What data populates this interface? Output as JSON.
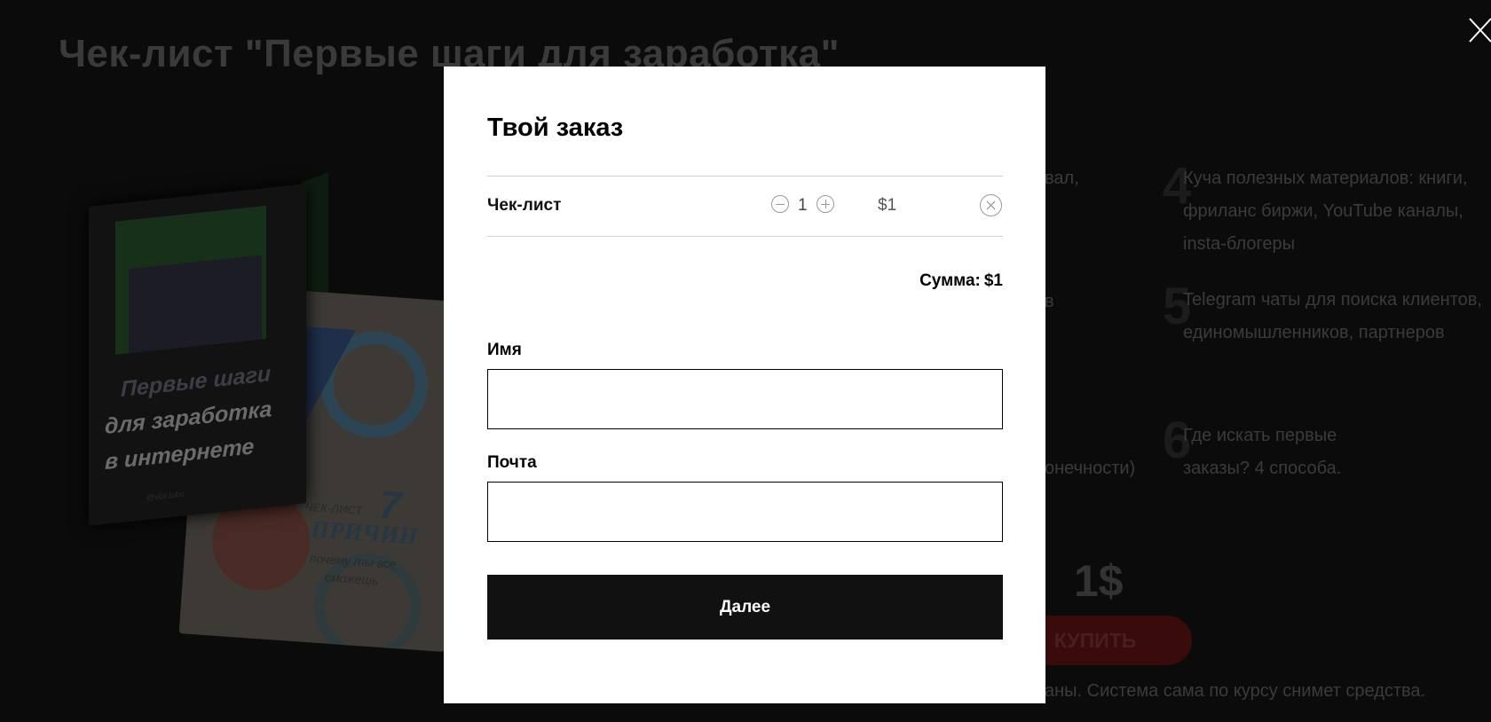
{
  "background": {
    "title": "Чек-лист \"Первые шаги для заработка\"",
    "cover_front": {
      "line1": "Первые шаги",
      "line2": "для заработка",
      "line3": "в интернете",
      "handle": "@vipr.tubs"
    },
    "cover_back": {
      "label": "ЧЕК-ЛИСТ",
      "number": "7",
      "title": "ПРИЧИН",
      "subtitle": "почему ты все сможешь"
    },
    "list": [
      {
        "num": "4",
        "text": "Куча полезных материалов: книги, фриланс биржи, YouTube каналы, insta-блогеры"
      },
      {
        "num": "5",
        "text": "Telegram чаты для поиска клиентов, единомышленников, партнеров"
      },
      {
        "num": "6",
        "text": "Где искать первые заказы? 4 способа."
      }
    ],
    "partial_fragments": [
      "вал,",
      "в",
      "онечности)"
    ],
    "price": "1$",
    "buy_label": "КУПИТЬ",
    "note": "аны. Система сама по курсу снимет средства."
  },
  "modal": {
    "title": "Твой заказ",
    "item": {
      "name": "Чек-лист",
      "quantity": "1",
      "price": "$1"
    },
    "sum_label": "Сумма:",
    "sum_value": "$1",
    "name_label": "Имя",
    "name_value": "",
    "email_label": "Почта",
    "email_value": "",
    "submit_label": "Далее"
  },
  "icons": {
    "close": "close-icon",
    "minus": "minus-circle-icon",
    "plus": "plus-circle-icon",
    "remove": "remove-circle-icon"
  }
}
